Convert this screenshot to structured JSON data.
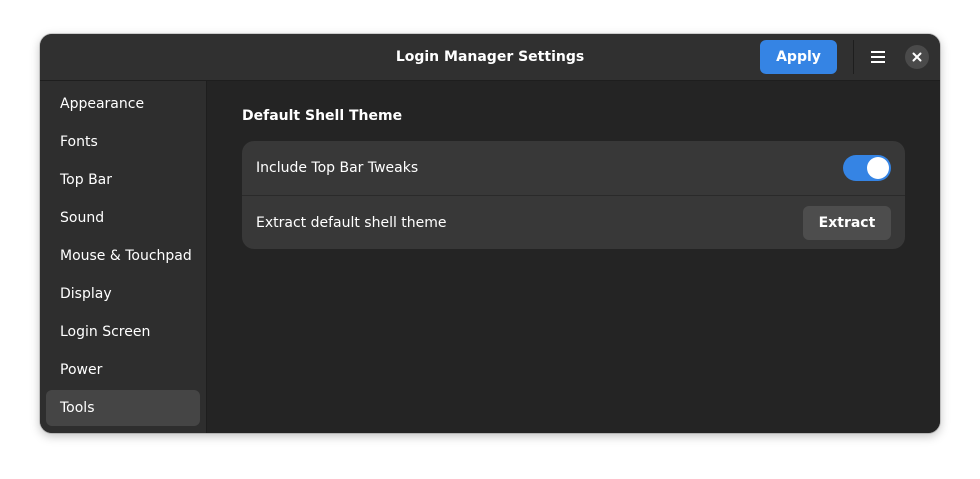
{
  "window": {
    "title": "Login Manager Settings"
  },
  "header": {
    "apply_label": "Apply",
    "menu_icon": "hamburger-menu-icon",
    "close_icon": "close-icon"
  },
  "sidebar": {
    "selected_index": 8,
    "items": [
      {
        "label": "Appearance"
      },
      {
        "label": "Fonts"
      },
      {
        "label": "Top Bar"
      },
      {
        "label": "Sound"
      },
      {
        "label": "Mouse & Touchpad"
      },
      {
        "label": "Display"
      },
      {
        "label": "Login Screen"
      },
      {
        "label": "Power"
      },
      {
        "label": "Tools"
      }
    ]
  },
  "main": {
    "section_title": "Default Shell Theme",
    "rows": [
      {
        "label": "Include Top Bar Tweaks",
        "control": "toggle",
        "toggle_on": true
      },
      {
        "label": "Extract default shell theme",
        "control": "button",
        "button_label": "Extract"
      }
    ]
  },
  "colors": {
    "accent": "#3584e4",
    "window_bg": "#242424",
    "sidebar_bg": "#2e2e2e",
    "card_bg": "#383838",
    "selected_bg": "#454545"
  }
}
